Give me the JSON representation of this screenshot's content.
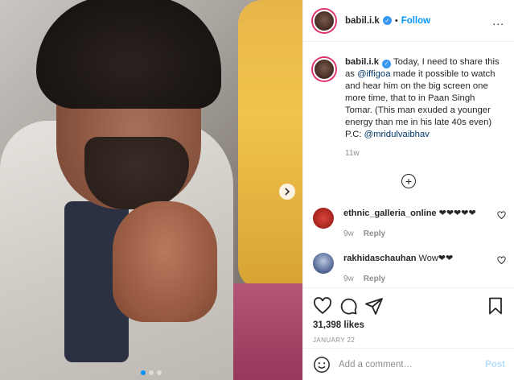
{
  "header": {
    "username": "babil.i.k",
    "follow_label": "Follow",
    "separator": "•",
    "more_label": "..."
  },
  "caption": {
    "username": "babil.i.k",
    "text_before": " Today, I need to share this as ",
    "mention1": "@iffigoa",
    "text_middle": " made it possible to watch and hear him on the big screen one more time, that to in Paan Singh Tomar. (This man exuded a younger energy than me in his late 40s even) P.C: ",
    "mention2": "@mridulvaibhav",
    "time_ago": "11w"
  },
  "load_more_label": "+",
  "comments": [
    {
      "username": "ethnic_galleria_online",
      "text": " ❤❤❤❤❤",
      "time": "9w",
      "reply_label": "Reply"
    },
    {
      "username": "rakhidaschauhan",
      "text": " Wow❤❤",
      "time": "9w",
      "reply_label": "Reply"
    }
  ],
  "post": {
    "likes": "31,398 likes",
    "date": "JANUARY 22"
  },
  "comment_box": {
    "placeholder": "Add a comment…",
    "post_label": "Post"
  },
  "icons": {
    "like": "heart-icon",
    "comment": "comment-icon",
    "share": "paper-plane-icon",
    "save": "bookmark-icon",
    "emoji": "emoji-icon",
    "next": "chevron-right-icon",
    "verified": "verified-badge-icon"
  },
  "colors": {
    "accent": "#0095f6",
    "mention": "#00376b",
    "muted": "#8e8e8e",
    "post_disabled": "#b2dffc"
  }
}
